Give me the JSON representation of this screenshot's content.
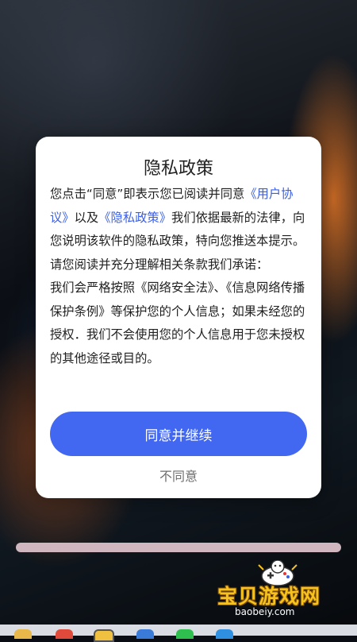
{
  "dialog": {
    "title": "隐私政策",
    "body_parts": [
      "您点击“同意”即表示您已阅读并同意",
      "《用户协议》",
      "以及",
      "《隐私政策》",
      "我们依据最新的法律，向您说明该软件的隐私政策，特向您推送本提示。请您阅读并充分理解相关条款我们承诺：",
      "我们会严格按照《网络安全法》、《信息网络传播保护条例》等保护您的个人信息；如果未经您的授权．我们不会使用您的个人信息用于您未授权的其他途径或目的。"
    ],
    "agree_button": "同意并继续",
    "disagree_button": "不同意"
  },
  "watermark": {
    "name": "宝贝游戏网",
    "url": "baobeiy.com"
  },
  "colors": {
    "accent": "#4267f0",
    "link": "#3a5fe6",
    "home_bar": "#cfb6bf",
    "watermark_text": "#f6c21f"
  },
  "taskbar": {
    "icons": [
      "folder-icon",
      "chrome-icon",
      "app-icon",
      "shield-icon",
      "wechat-icon",
      "browser-icon"
    ]
  }
}
